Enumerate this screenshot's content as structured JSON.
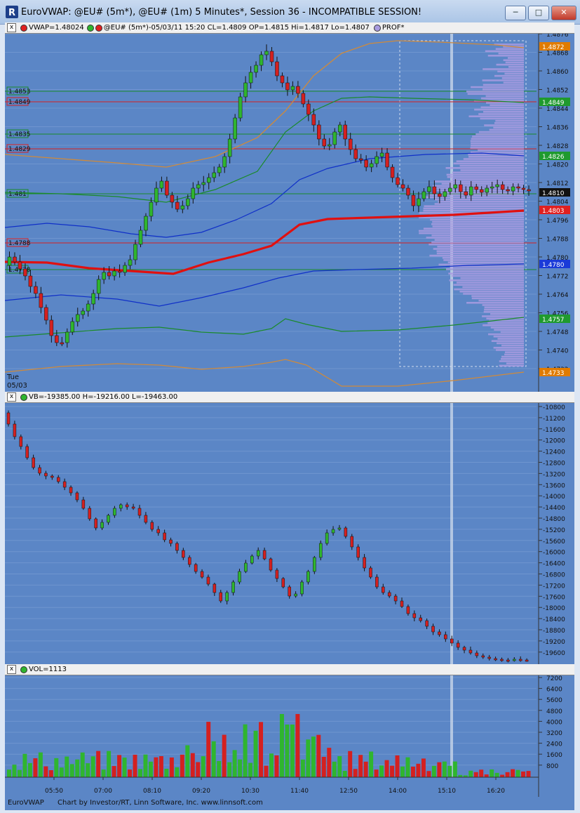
{
  "window": {
    "title": "EuroVWAP: @EU# (5m*), @EU# (1m) 5 Minutes*, Session 36 - INCOMPATIBLE SESSION!",
    "min_label": "─",
    "max_label": "□",
    "close_label": "✕"
  },
  "panes": {
    "price": {
      "header": {
        "close": "x",
        "vwap_label": "VWAP=1.48024",
        "bars_label": "@EU# (5m*)-05/03/11 15:20 CL=1.4809 OP=1.4815 Hi=1.4817 Lo=1.4807",
        "prof_label": "PROF*"
      },
      "y_axis_ticks": [
        "1.4876",
        "1.4868",
        "1.4860",
        "1.4852",
        "1.4844",
        "1.4836",
        "1.4828",
        "1.4820",
        "1.4812",
        "1.4804",
        "1.4796",
        "1.4788",
        "1.4780",
        "1.4772",
        "1.4764",
        "1.4756",
        "1.4748",
        "1.4740",
        "1.4732"
      ],
      "left_level_labels": [
        "1.4853",
        "1.4849",
        "1.4835",
        "1.4829",
        "1.481",
        "1.4788",
        "1.4778"
      ],
      "right_badges": [
        {
          "text": "1.4872",
          "color": "#e07b00"
        },
        {
          "text": "1.4849",
          "color": "#1f9a2e"
        },
        {
          "text": "1.4826",
          "color": "#1f9a2e"
        },
        {
          "text": "1.4810",
          "color": "#111111"
        },
        {
          "text": "1.4803",
          "color": "#e02020"
        },
        {
          "text": "1.4780",
          "color": "#1a3ad8"
        },
        {
          "text": "1.4757",
          "color": "#1f9a2e"
        },
        {
          "text": "1.4733",
          "color": "#e07b00"
        }
      ],
      "session_label_day": "Tue",
      "session_label_date": "05/03"
    },
    "vb": {
      "header": {
        "close": "x",
        "label": "VB=-19385.00 H=-19216.00 L=-19463.00"
      },
      "y_axis_ticks": [
        "-10800",
        "-11200",
        "-11600",
        "-12000",
        "-12400",
        "-12800",
        "-13200",
        "-13600",
        "-14000",
        "-14400",
        "-14800",
        "-15200",
        "-15600",
        "-16000",
        "-16400",
        "-16800",
        "-17200",
        "-17600",
        "-18000",
        "-18400",
        "-18800",
        "-19200",
        "-19600"
      ]
    },
    "vol": {
      "header": {
        "close": "x",
        "label": "VOL=1113"
      },
      "y_axis_ticks": [
        "7200",
        "6400",
        "5600",
        "4800",
        "4000",
        "3200",
        "2400",
        "1600",
        "800"
      ],
      "x_axis_ticks": [
        "05:50",
        "07:00",
        "08:10",
        "09:20",
        "10:30",
        "11:40",
        "12:50",
        "14:00",
        "15:10",
        "16:20"
      ]
    }
  },
  "footer": {
    "left": "EuroVWAP",
    "credit": "Chart by Investor/RT, Linn Software, Inc. www.linnsoft.com"
  },
  "colors": {
    "background": "#5b86c6",
    "up_candle": "#2fb52f",
    "down_candle": "#d42020",
    "vwap": "#e01010",
    "band1": "#1030c8",
    "band2": "#1a8a2a",
    "band3": "#d08a3a",
    "profile": "#a99be0"
  }
}
